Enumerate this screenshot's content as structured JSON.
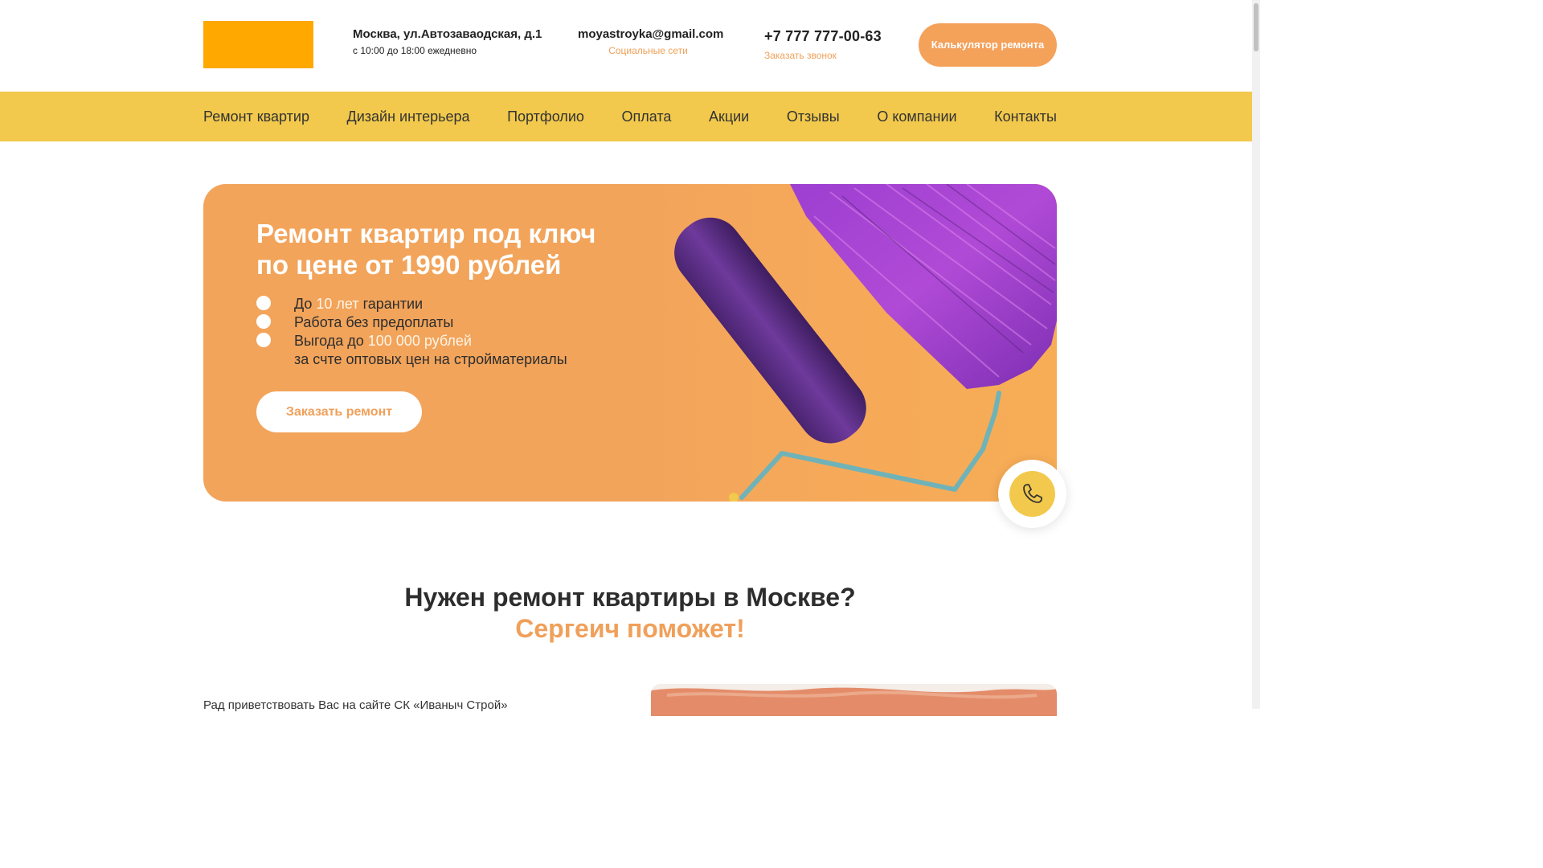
{
  "header": {
    "address": "Москва, ул.Автозаваодская, д.1",
    "hours": "с 10:00 до 18:00 ежедневно",
    "email": "moyastroyka@gmail.com",
    "social_label": "Социальные сети",
    "phone": "+7 777 777-00-63",
    "callback_label": "Заказать звонок",
    "calc_button": "Калькулятор ремонта"
  },
  "nav": {
    "items": [
      {
        "label": "Ремонт квартир"
      },
      {
        "label": "Дизайн интерьера"
      },
      {
        "label": "Портфолио"
      },
      {
        "label": "Оплата"
      },
      {
        "label": "Акции"
      },
      {
        "label": "Отзывы"
      },
      {
        "label": "О компании"
      },
      {
        "label": "Контакты"
      }
    ]
  },
  "hero": {
    "title_line1": "Ремонт квартир под ключ",
    "title_line2": "по цене от 1990 рублей",
    "b1_pre": "До ",
    "b1_hl": "10 лет",
    "b1_post": " гарантии",
    "b2": "Работа без предоплаты",
    "b3_pre": "Выгода до ",
    "b3_hl": "100 000 рублей",
    "b3_line2": "за счте оптовых цен на стройматериалы",
    "button": "Заказать ремонт",
    "image_icon": "paint-roller-photo"
  },
  "call_widget": {
    "icon": "phone-icon"
  },
  "section": {
    "title_line1": "Нужен ремонт квартиры в Москве?",
    "title_line2": "Сергеич поможет!",
    "intro": "Рад приветствовать Вас на сайте СК «Иваныч Строй»"
  },
  "colors": {
    "accent": "#f0a05a",
    "logo": "#ffa800",
    "nav_bg": "#f2c94c",
    "hero_bg": "#f2a45b"
  }
}
